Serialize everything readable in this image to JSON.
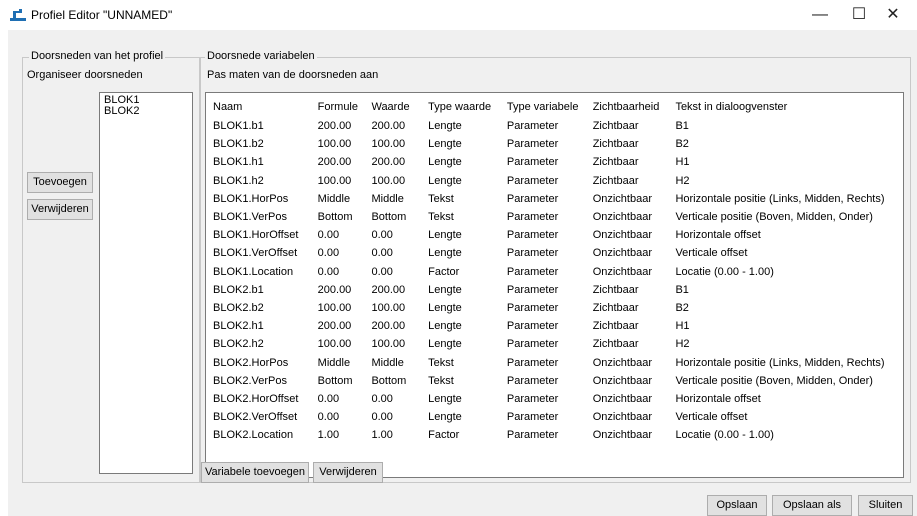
{
  "window": {
    "title": "Profiel Editor \"UNNAMED\"",
    "min_glyph": "—",
    "max_glyph": "☐",
    "close_glyph": "✕"
  },
  "profile_group": {
    "legend": "Doorsneden van het profiel",
    "subtitle": "Organiseer doorsneden",
    "add_button": "Toevoegen",
    "remove_button": "Verwijderen",
    "sections": [
      "BLOK1",
      "BLOK2"
    ]
  },
  "variables_group": {
    "legend": "Doorsnede variabelen",
    "subtitle": "Pas maten van de doorsneden aan",
    "columns": [
      "Naam",
      "Formule",
      "Waarde",
      "Type waarde",
      "Type variabele",
      "Zichtbaarheid",
      "Tekst in dialoogvenster"
    ],
    "rows": [
      [
        "BLOK1.b1",
        "200.00",
        "200.00",
        "Lengte",
        "Parameter",
        "Zichtbaar",
        "B1"
      ],
      [
        "BLOK1.b2",
        "100.00",
        "100.00",
        "Lengte",
        "Parameter",
        "Zichtbaar",
        "B2"
      ],
      [
        "BLOK1.h1",
        "200.00",
        "200.00",
        "Lengte",
        "Parameter",
        "Zichtbaar",
        "H1"
      ],
      [
        "BLOK1.h2",
        "100.00",
        "100.00",
        "Lengte",
        "Parameter",
        "Zichtbaar",
        "H2"
      ],
      [
        "BLOK1.HorPos",
        "Middle",
        "Middle",
        "Tekst",
        "Parameter",
        "Onzichtbaar",
        "Horizontale positie (Links, Midden, Rechts)"
      ],
      [
        "BLOK1.VerPos",
        "Bottom",
        "Bottom",
        "Tekst",
        "Parameter",
        "Onzichtbaar",
        "Verticale positie (Boven, Midden, Onder)"
      ],
      [
        "BLOK1.HorOffset",
        "0.00",
        "0.00",
        "Lengte",
        "Parameter",
        "Onzichtbaar",
        "Horizontale offset"
      ],
      [
        "BLOK1.VerOffset",
        "0.00",
        "0.00",
        "Lengte",
        "Parameter",
        "Onzichtbaar",
        "Verticale offset"
      ],
      [
        "BLOK1.Location",
        "0.00",
        "0.00",
        "Factor",
        "Parameter",
        "Onzichtbaar",
        "Locatie (0.00 - 1.00)"
      ],
      [
        "BLOK2.b1",
        "200.00",
        "200.00",
        "Lengte",
        "Parameter",
        "Zichtbaar",
        "B1"
      ],
      [
        "BLOK2.b2",
        "100.00",
        "100.00",
        "Lengte",
        "Parameter",
        "Zichtbaar",
        "B2"
      ],
      [
        "BLOK2.h1",
        "200.00",
        "200.00",
        "Lengte",
        "Parameter",
        "Zichtbaar",
        "H1"
      ],
      [
        "BLOK2.h2",
        "100.00",
        "100.00",
        "Lengte",
        "Parameter",
        "Zichtbaar",
        "H2"
      ],
      [
        "BLOK2.HorPos",
        "Middle",
        "Middle",
        "Tekst",
        "Parameter",
        "Onzichtbaar",
        "Horizontale positie (Links, Midden, Rechts)"
      ],
      [
        "BLOK2.VerPos",
        "Bottom",
        "Bottom",
        "Tekst",
        "Parameter",
        "Onzichtbaar",
        "Verticale positie (Boven, Midden, Onder)"
      ],
      [
        "BLOK2.HorOffset",
        "0.00",
        "0.00",
        "Lengte",
        "Parameter",
        "Onzichtbaar",
        "Horizontale offset"
      ],
      [
        "BLOK2.VerOffset",
        "0.00",
        "0.00",
        "Lengte",
        "Parameter",
        "Onzichtbaar",
        "Verticale offset"
      ],
      [
        "BLOK2.Location",
        "1.00",
        "1.00",
        "Factor",
        "Parameter",
        "Onzichtbaar",
        "Locatie (0.00 - 1.00)"
      ]
    ],
    "add_variable_button": "Variabele toevoegen",
    "remove_variable_button": "Verwijderen"
  },
  "footer": {
    "save_button": "Opslaan",
    "save_as_button": "Opslaan als",
    "close_button": "Sluiten"
  }
}
